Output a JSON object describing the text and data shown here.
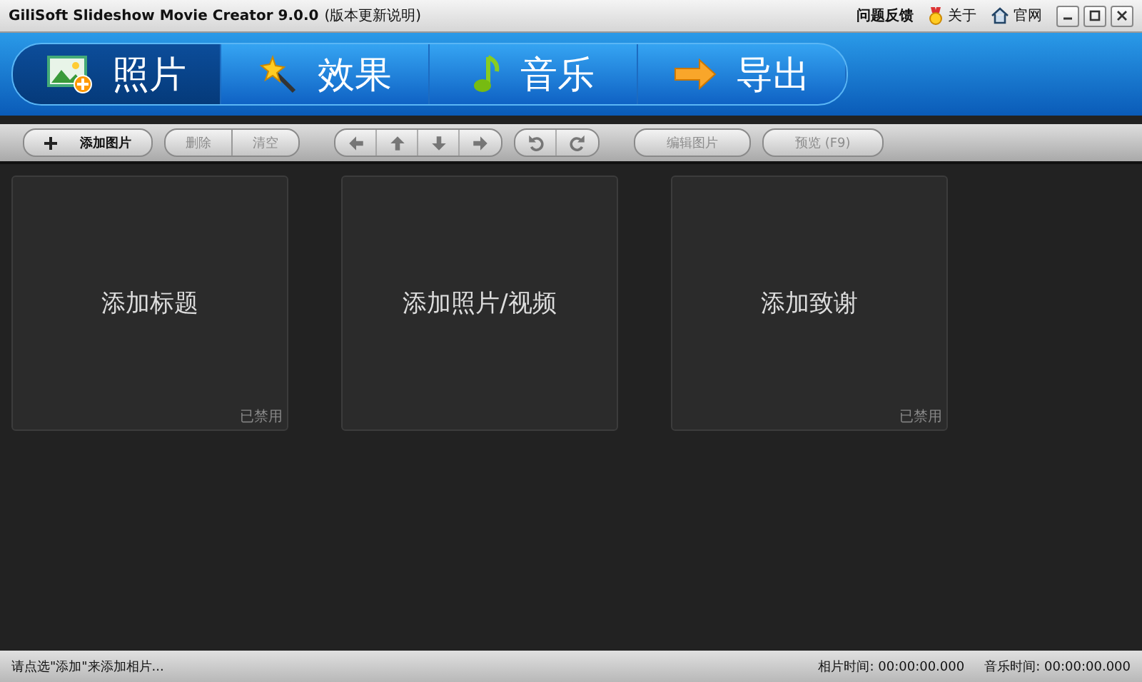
{
  "window": {
    "title": "GiliSoft Slideshow Movie Creator 9.0.0",
    "title_note": "(版本更新说明)",
    "links": [
      {
        "kind": "text",
        "label": "问题反馈"
      },
      {
        "kind": "award",
        "label": "关于"
      },
      {
        "kind": "home",
        "label": "官网"
      }
    ]
  },
  "tabs": [
    {
      "kind": "photo",
      "label": "照片",
      "selected": true
    },
    {
      "kind": "wand",
      "label": "效果",
      "selected": false
    },
    {
      "kind": "music",
      "label": "音乐",
      "selected": false
    },
    {
      "kind": "export",
      "label": "导出",
      "selected": false
    }
  ],
  "toolbar": [
    {
      "kind": "text",
      "buttons": [
        {
          "kind": "add",
          "label": "添加图片",
          "disabled": false
        }
      ]
    },
    {
      "kind": "text",
      "buttons": [
        {
          "kind": "text",
          "label": "删除",
          "disabled": true
        },
        {
          "kind": "text",
          "label": "清空",
          "disabled": true
        }
      ]
    },
    {
      "kind": "icons",
      "buttons": [
        {
          "kind": "left",
          "disabled": true
        },
        {
          "kind": "up",
          "disabled": true
        },
        {
          "kind": "down",
          "disabled": true
        },
        {
          "kind": "right",
          "disabled": true
        }
      ]
    },
    {
      "kind": "icons",
      "buttons": [
        {
          "kind": "rotl",
          "disabled": true
        },
        {
          "kind": "rotr",
          "disabled": true
        }
      ]
    },
    {
      "kind": "text",
      "buttons": [
        {
          "kind": "text",
          "label": "编辑图片",
          "disabled": true
        }
      ]
    },
    {
      "kind": "text",
      "buttons": [
        {
          "kind": "text",
          "label": "预览 (F9)",
          "disabled": true
        }
      ]
    }
  ],
  "cards": [
    {
      "label": "添加标题",
      "badge": "已禁用"
    },
    {
      "label": "添加照片/视频"
    },
    {
      "label": "添加致谢",
      "badge": "已禁用"
    }
  ],
  "status_bar": {
    "message": "请点选\"添加\"来添加相片...",
    "fields": [
      {
        "label": "相片时间:",
        "value": "00:00:00.000"
      },
      {
        "label": "音乐时间:",
        "value": "00:00:00.000"
      }
    ]
  }
}
